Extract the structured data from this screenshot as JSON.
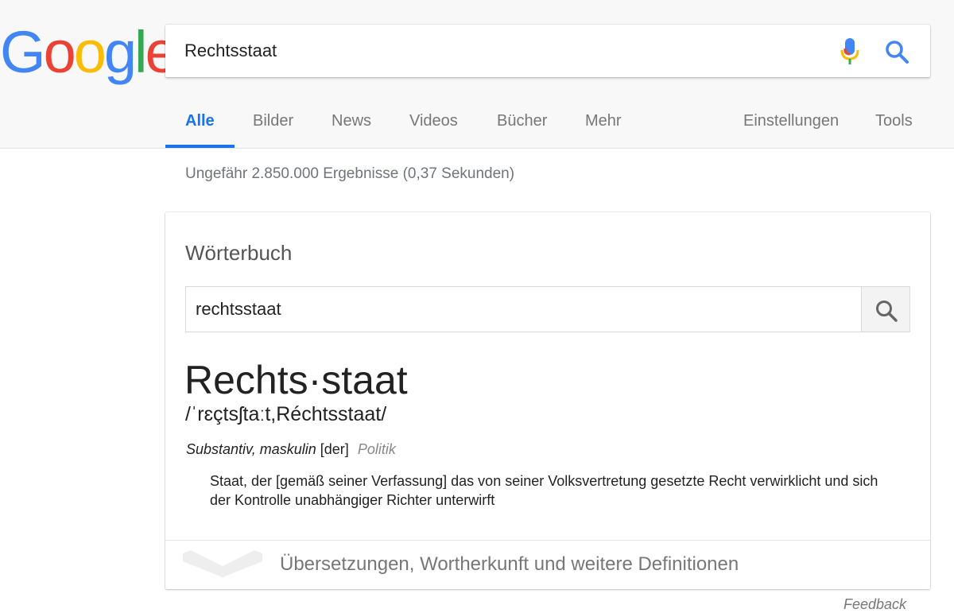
{
  "logo": {
    "text": "Google",
    "colors": [
      "#4285F4",
      "#EA4335",
      "#FBBC05",
      "#4285F4",
      "#34A853",
      "#EA4335"
    ]
  },
  "search": {
    "query": "Rechtsstaat"
  },
  "icons": {
    "mic": "microphone-icon",
    "search": "search-icon"
  },
  "tabs": [
    {
      "label": "Alle",
      "active": true
    },
    {
      "label": "Bilder"
    },
    {
      "label": "News"
    },
    {
      "label": "Videos"
    },
    {
      "label": "Bücher"
    },
    {
      "label": "Mehr"
    },
    {
      "label": "Einstellungen"
    },
    {
      "label": "Tools"
    }
  ],
  "stats": {
    "text": "Ungefähr 2.850.000 Ergebnisse (0,37 Sekunden)"
  },
  "dictionary": {
    "title": "Wörterbuch",
    "search_value": "rechtsstaat",
    "headword": "Rechts·staat",
    "phonetic": "/ˈrɛçtsʃtaːt,Réchtsstaat/",
    "part_of_speech": "Substantiv, maskulin",
    "article": "[der]",
    "domain": "Politik",
    "definition": "Staat, der [gemäß seiner Verfassung] das von seiner Volksvertretung gesetzte Recht verwirklicht und sich der Kontrolle unabhängiger Richter unterwirft",
    "more_label": "Übersetzungen, Wortherkunft und weitere Definitionen"
  },
  "feedback": {
    "label": "Feedback"
  },
  "colors": {
    "accent": "#1a73e8",
    "muted": "#777777"
  }
}
